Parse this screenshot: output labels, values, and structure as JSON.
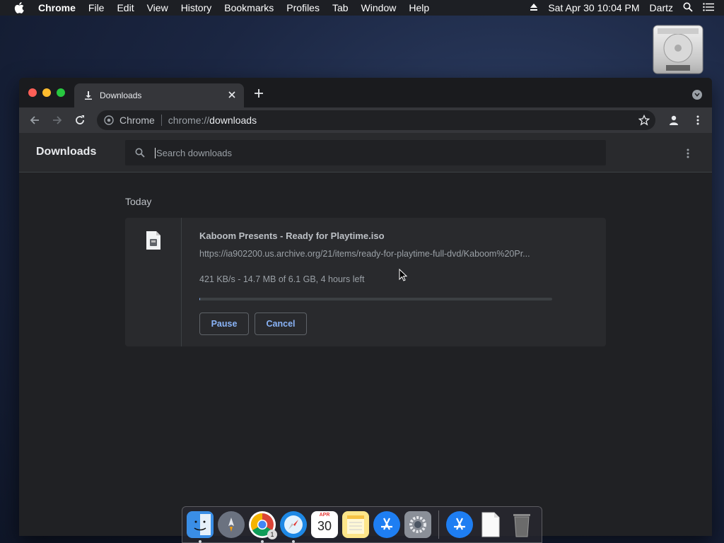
{
  "menubar": {
    "app_name": "Chrome",
    "items": [
      "File",
      "Edit",
      "View",
      "History",
      "Bookmarks",
      "Profiles",
      "Tab",
      "Window",
      "Help"
    ],
    "datetime": "Sat Apr 30  10:04 PM",
    "user": "Dartz"
  },
  "tab": {
    "title": "Downloads"
  },
  "omnibox": {
    "chip": "Chrome",
    "scheme": "chrome://",
    "host": "downloads"
  },
  "downloads": {
    "title": "Downloads",
    "search_placeholder": "Search downloads",
    "date_header": "Today",
    "item": {
      "file_name": "Kaboom Presents - Ready for Playtime.iso",
      "url": "https://ia902200.us.archive.org/21/items/ready-for-playtime-full-dvd/Kaboom%20Pr...",
      "status": "421 KB/s - 14.7 MB of 6.1 GB, 4 hours left",
      "progress_fraction": 0.0024,
      "pause_label": "Pause",
      "cancel_label": "Cancel"
    }
  },
  "dock": {
    "apps": [
      "finder-icon",
      "launchpad-icon",
      "chrome-icon",
      "safari-icon",
      "calendar-icon",
      "notes-icon",
      "app-store-icon",
      "system-preferences-icon"
    ],
    "calendar_month": "APR",
    "calendar_day": "30",
    "chrome_badge": "1",
    "colors": {
      "finder": "#3a8ee6",
      "safari": "#1e88e5",
      "appstore": "#1e7ef2"
    }
  }
}
